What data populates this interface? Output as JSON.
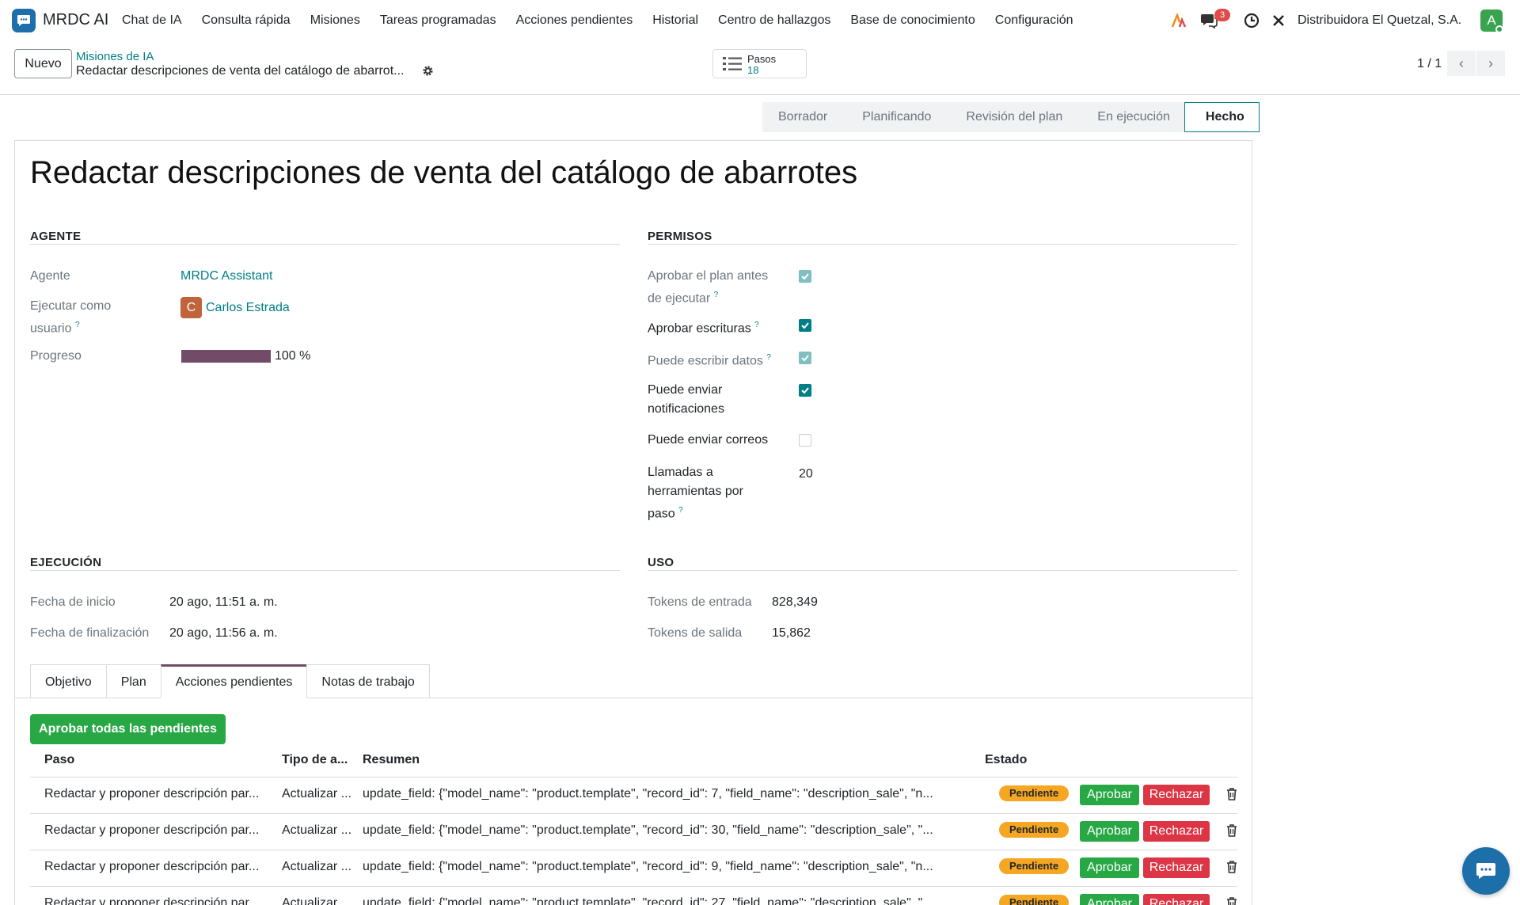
{
  "app": {
    "name": "MRDC AI"
  },
  "menu": [
    "Chat de IA",
    "Consulta rápida",
    "Misiones",
    "Tareas programadas",
    "Acciones pendientes",
    "Historial",
    "Centro de hallazgos",
    "Base de conocimiento",
    "Configuración"
  ],
  "systray": {
    "messages_count": "3",
    "company": "Distribuidora El Quetzal, S.A.",
    "user_initial": "A"
  },
  "control_panel": {
    "new_button": "Nuevo",
    "breadcrumb_parent": "Misiones de IA",
    "breadcrumb_current": "Redactar descripciones de venta del catálogo de abarrot...",
    "steps_label": "Pasos",
    "steps_value": "18",
    "pager": "1 / 1"
  },
  "stages": [
    "Borrador",
    "Planificando",
    "Revisión del plan",
    "En ejecución",
    "Hecho"
  ],
  "active_stage": "Hecho",
  "record": {
    "title": "Redactar descripciones de venta del catálogo de abarrotes",
    "agent_section": "AGENTE",
    "agent_label": "Agente",
    "agent_value": "MRDC Assistant",
    "run_as_label_1": "Ejecutar como",
    "run_as_label_2": "usuario",
    "run_as_initial": "C",
    "run_as_value": "Carlos Estrada",
    "progress_label": "Progreso",
    "progress_value": 1.0,
    "progress_text": "100 %",
    "permissions_section": "PERMISOS",
    "permissions": [
      {
        "label_1": "Aprobar el plan antes",
        "label_2": "de ejecutar",
        "checked": true,
        "readonly": true,
        "help": "?"
      },
      {
        "label_1": "Aprobar escrituras",
        "label_2": "",
        "checked": true,
        "readonly": false,
        "help": "?"
      },
      {
        "label_1": "Puede escribir datos",
        "label_2": "",
        "checked": true,
        "readonly": true,
        "help": "?"
      },
      {
        "label_1": "Puede enviar",
        "label_2": "notificaciones",
        "checked": true,
        "readonly": false,
        "help": ""
      },
      {
        "label_1": "Puede enviar correos",
        "label_2": "",
        "checked": false,
        "readonly": false,
        "help": ""
      }
    ],
    "tool_calls_label_1": "Llamadas a",
    "tool_calls_label_2": "herramientas por",
    "tool_calls_label_3": "paso",
    "tool_calls_value": "20",
    "execution_section": "EJECUCIÓN",
    "start_label": "Fecha de inicio",
    "start_value": "20 ago, 11:51 a. m.",
    "end_label": "Fecha de finalización",
    "end_value": "20 ago, 11:56 a. m.",
    "usage_section": "USO",
    "tokens_in_label": "Tokens de entrada",
    "tokens_in_value": "828,349",
    "tokens_out_label": "Tokens de salida",
    "tokens_out_value": "15,862"
  },
  "tabs": [
    "Objetivo",
    "Plan",
    "Acciones pendientes",
    "Notas de trabajo"
  ],
  "active_tab": "Acciones pendientes",
  "actions": {
    "approve_all": "Aprobar todas las pendientes",
    "columns": [
      "Paso",
      "Tipo de a...",
      "Resumen",
      "Estado"
    ],
    "approve_label": "Aprobar",
    "reject_label": "Rechazar",
    "rows": [
      {
        "step": "Redactar y proponer descripción par...",
        "type": "Actualizar ...",
        "summary": "update_field: {\"model_name\": \"product.template\", \"record_id\": 7, \"field_name\": \"description_sale\", \"n...",
        "status": "Pendiente"
      },
      {
        "step": "Redactar y proponer descripción par...",
        "type": "Actualizar ...",
        "summary": "update_field: {\"model_name\": \"product.template\", \"record_id\": 30, \"field_name\": \"description_sale\", \"...",
        "status": "Pendiente"
      },
      {
        "step": "Redactar y proponer descripción par...",
        "type": "Actualizar ...",
        "summary": "update_field: {\"model_name\": \"product.template\", \"record_id\": 9, \"field_name\": \"description_sale\", \"n...",
        "status": "Pendiente"
      },
      {
        "step": "Redactar y proponer descripción par...",
        "type": "Actualizar ...",
        "summary": "update_field: {\"model_name\": \"product.template\", \"record_id\": 27, \"field_name\": \"description_sale\", \"...",
        "status": "Pendiente"
      }
    ]
  },
  "colors": {
    "primary": "#017e84",
    "brand": "#714b67",
    "success": "#28a745",
    "danger": "#dc3545",
    "warning": "#f5a623"
  },
  "icons": [
    "app-logo-icon",
    "ai-sparkle-icon",
    "messages-icon",
    "clock-icon",
    "tools-icon",
    "gear-icon",
    "list-steps-icon",
    "chevron-left-icon",
    "chevron-right-icon",
    "trash-icon",
    "chat-icon"
  ]
}
